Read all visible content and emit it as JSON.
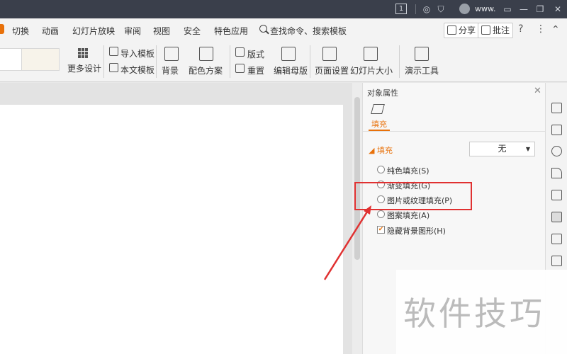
{
  "titlebar": {
    "badge": "1",
    "user": "www.",
    "min": "—",
    "restore": "❐",
    "close": "✕"
  },
  "tabs": [
    "切换",
    "动画",
    "幻灯片放映",
    "审阅",
    "视图",
    "安全",
    "特色应用",
    "查找命令、搜索模板"
  ],
  "actions": {
    "share": "分享",
    "annotate": "批注",
    "help": "?",
    "more": "⋮",
    "collapse": "⌃"
  },
  "ribbon": {
    "more_design": "更多设计",
    "import_template": "导入模板",
    "text_template": "本文模板",
    "background": "背景",
    "color_scheme": "配色方案",
    "layout": "版式",
    "reset": "重置",
    "edit_master": "编辑母版",
    "page_setup": "页面设置",
    "slide_size": "幻灯片大小",
    "present_tools": "演示工具"
  },
  "panel": {
    "title": "对象属性",
    "fill_tab": "填充",
    "section": "填充",
    "dropdown_value": "无",
    "options": [
      {
        "label": "纯色填充(S)",
        "type": "radio",
        "checked": false
      },
      {
        "label": "渐变填充(G)",
        "type": "radio",
        "checked": false
      },
      {
        "label": "图片或纹理填充(P)",
        "type": "radio",
        "checked": false
      },
      {
        "label": "图案填充(A)",
        "type": "radio",
        "checked": false
      },
      {
        "label": "隐藏背景图形(H)",
        "type": "checkbox",
        "checked": true
      }
    ]
  },
  "watermark": "软件技巧",
  "colors": {
    "accent": "#e8710a",
    "highlight": "#e03131",
    "titlebar": "#3a3f4b"
  }
}
